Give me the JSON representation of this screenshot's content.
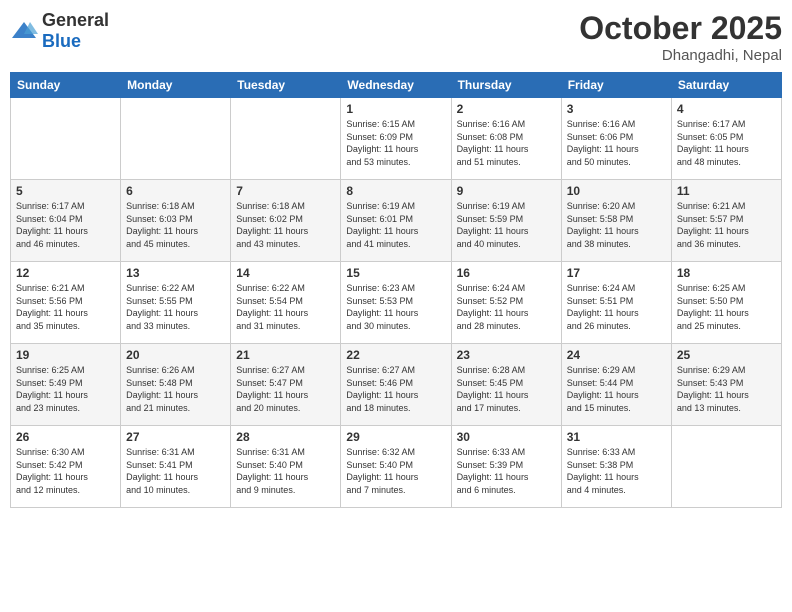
{
  "header": {
    "logo_general": "General",
    "logo_blue": "Blue",
    "month": "October 2025",
    "location": "Dhangadhi, Nepal"
  },
  "days_of_week": [
    "Sunday",
    "Monday",
    "Tuesday",
    "Wednesday",
    "Thursday",
    "Friday",
    "Saturday"
  ],
  "weeks": [
    [
      {
        "day": "",
        "info": ""
      },
      {
        "day": "",
        "info": ""
      },
      {
        "day": "",
        "info": ""
      },
      {
        "day": "1",
        "info": "Sunrise: 6:15 AM\nSunset: 6:09 PM\nDaylight: 11 hours\nand 53 minutes."
      },
      {
        "day": "2",
        "info": "Sunrise: 6:16 AM\nSunset: 6:08 PM\nDaylight: 11 hours\nand 51 minutes."
      },
      {
        "day": "3",
        "info": "Sunrise: 6:16 AM\nSunset: 6:06 PM\nDaylight: 11 hours\nand 50 minutes."
      },
      {
        "day": "4",
        "info": "Sunrise: 6:17 AM\nSunset: 6:05 PM\nDaylight: 11 hours\nand 48 minutes."
      }
    ],
    [
      {
        "day": "5",
        "info": "Sunrise: 6:17 AM\nSunset: 6:04 PM\nDaylight: 11 hours\nand 46 minutes."
      },
      {
        "day": "6",
        "info": "Sunrise: 6:18 AM\nSunset: 6:03 PM\nDaylight: 11 hours\nand 45 minutes."
      },
      {
        "day": "7",
        "info": "Sunrise: 6:18 AM\nSunset: 6:02 PM\nDaylight: 11 hours\nand 43 minutes."
      },
      {
        "day": "8",
        "info": "Sunrise: 6:19 AM\nSunset: 6:01 PM\nDaylight: 11 hours\nand 41 minutes."
      },
      {
        "day": "9",
        "info": "Sunrise: 6:19 AM\nSunset: 5:59 PM\nDaylight: 11 hours\nand 40 minutes."
      },
      {
        "day": "10",
        "info": "Sunrise: 6:20 AM\nSunset: 5:58 PM\nDaylight: 11 hours\nand 38 minutes."
      },
      {
        "day": "11",
        "info": "Sunrise: 6:21 AM\nSunset: 5:57 PM\nDaylight: 11 hours\nand 36 minutes."
      }
    ],
    [
      {
        "day": "12",
        "info": "Sunrise: 6:21 AM\nSunset: 5:56 PM\nDaylight: 11 hours\nand 35 minutes."
      },
      {
        "day": "13",
        "info": "Sunrise: 6:22 AM\nSunset: 5:55 PM\nDaylight: 11 hours\nand 33 minutes."
      },
      {
        "day": "14",
        "info": "Sunrise: 6:22 AM\nSunset: 5:54 PM\nDaylight: 11 hours\nand 31 minutes."
      },
      {
        "day": "15",
        "info": "Sunrise: 6:23 AM\nSunset: 5:53 PM\nDaylight: 11 hours\nand 30 minutes."
      },
      {
        "day": "16",
        "info": "Sunrise: 6:24 AM\nSunset: 5:52 PM\nDaylight: 11 hours\nand 28 minutes."
      },
      {
        "day": "17",
        "info": "Sunrise: 6:24 AM\nSunset: 5:51 PM\nDaylight: 11 hours\nand 26 minutes."
      },
      {
        "day": "18",
        "info": "Sunrise: 6:25 AM\nSunset: 5:50 PM\nDaylight: 11 hours\nand 25 minutes."
      }
    ],
    [
      {
        "day": "19",
        "info": "Sunrise: 6:25 AM\nSunset: 5:49 PM\nDaylight: 11 hours\nand 23 minutes."
      },
      {
        "day": "20",
        "info": "Sunrise: 6:26 AM\nSunset: 5:48 PM\nDaylight: 11 hours\nand 21 minutes."
      },
      {
        "day": "21",
        "info": "Sunrise: 6:27 AM\nSunset: 5:47 PM\nDaylight: 11 hours\nand 20 minutes."
      },
      {
        "day": "22",
        "info": "Sunrise: 6:27 AM\nSunset: 5:46 PM\nDaylight: 11 hours\nand 18 minutes."
      },
      {
        "day": "23",
        "info": "Sunrise: 6:28 AM\nSunset: 5:45 PM\nDaylight: 11 hours\nand 17 minutes."
      },
      {
        "day": "24",
        "info": "Sunrise: 6:29 AM\nSunset: 5:44 PM\nDaylight: 11 hours\nand 15 minutes."
      },
      {
        "day": "25",
        "info": "Sunrise: 6:29 AM\nSunset: 5:43 PM\nDaylight: 11 hours\nand 13 minutes."
      }
    ],
    [
      {
        "day": "26",
        "info": "Sunrise: 6:30 AM\nSunset: 5:42 PM\nDaylight: 11 hours\nand 12 minutes."
      },
      {
        "day": "27",
        "info": "Sunrise: 6:31 AM\nSunset: 5:41 PM\nDaylight: 11 hours\nand 10 minutes."
      },
      {
        "day": "28",
        "info": "Sunrise: 6:31 AM\nSunset: 5:40 PM\nDaylight: 11 hours\nand 9 minutes."
      },
      {
        "day": "29",
        "info": "Sunrise: 6:32 AM\nSunset: 5:40 PM\nDaylight: 11 hours\nand 7 minutes."
      },
      {
        "day": "30",
        "info": "Sunrise: 6:33 AM\nSunset: 5:39 PM\nDaylight: 11 hours\nand 6 minutes."
      },
      {
        "day": "31",
        "info": "Sunrise: 6:33 AM\nSunset: 5:38 PM\nDaylight: 11 hours\nand 4 minutes."
      },
      {
        "day": "",
        "info": ""
      }
    ]
  ]
}
